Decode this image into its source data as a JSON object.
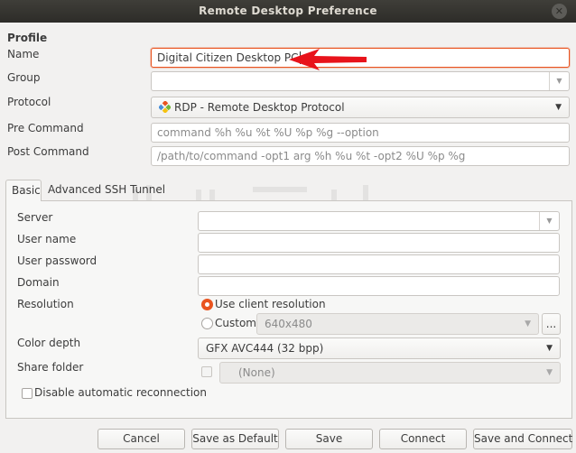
{
  "window": {
    "title": "Remote Desktop Preference"
  },
  "profile": {
    "section_label": "Profile",
    "name_label": "Name",
    "name_value": "Digital Citizen Desktop PC",
    "group_label": "Group",
    "group_value": "",
    "protocol_label": "Protocol",
    "protocol_value": "RDP - Remote Desktop Protocol",
    "pre_command_label": "Pre Command",
    "pre_command_placeholder": "command %h %u %t %U %p %g --option",
    "post_command_label": "Post Command",
    "post_command_placeholder": "/path/to/command -opt1 arg %h %u %t -opt2 %U %p %g"
  },
  "tabs": [
    {
      "label": "Basic",
      "active": true
    },
    {
      "label": "Advanced",
      "active": false
    },
    {
      "label": "SSH Tunnel",
      "active": false
    }
  ],
  "basic": {
    "server_label": "Server",
    "server_value": "",
    "username_label": "User name",
    "username_value": "",
    "password_label": "User password",
    "password_value": "",
    "domain_label": "Domain",
    "domain_value": "",
    "resolution_label": "Resolution",
    "resolution_client_label": "Use client resolution",
    "resolution_custom_label": "Custom",
    "resolution_custom_value": "640x480",
    "resolution_more_label": "...",
    "color_depth_label": "Color depth",
    "color_depth_value": "GFX AVC444 (32 bpp)",
    "share_folder_label": "Share folder",
    "share_folder_value": "(None)",
    "disable_reconnect_label": "Disable automatic reconnection"
  },
  "buttons": {
    "cancel": "Cancel",
    "save_default": "Save as Default",
    "save": "Save",
    "connect": "Connect",
    "save_connect": "Save and Connect"
  },
  "colors": {
    "accent": "#e95420",
    "annotation_arrow": "#e8131b",
    "titlebar": "#2d2c28"
  },
  "icons": {
    "window_close": "close-icon",
    "protocol": "rdp-plugin-icon",
    "dropdown": "chevron-down-icon"
  }
}
